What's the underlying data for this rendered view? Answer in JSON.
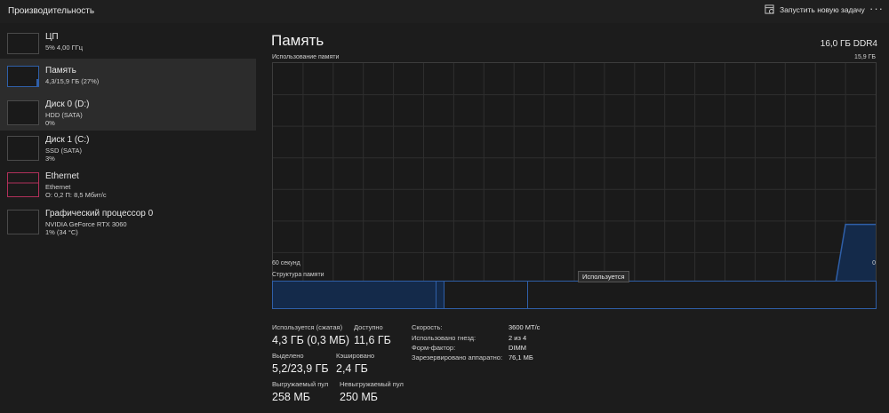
{
  "header": {
    "title": "Производительность",
    "run_task_label": "Запустить новую задачу",
    "more_label": "···"
  },
  "sidebar": {
    "items": [
      {
        "name": "ЦП",
        "subs": [
          "5% 4,00 ГГц"
        ]
      },
      {
        "name": "Память",
        "subs": [
          "4,3/15,9 ГБ (27%)"
        ]
      },
      {
        "name": "Диск 0 (D:)",
        "subs": [
          "HDD (SATA)",
          "0%"
        ]
      },
      {
        "name": "Диск 1 (C:)",
        "subs": [
          "SSD (SATA)",
          "3%"
        ]
      },
      {
        "name": "Ethernet",
        "subs": [
          "Ethernet",
          "О: 0,2 П: 8,5 Мбит/с"
        ]
      },
      {
        "name": "Графический процессор 0",
        "subs": [
          "NVIDIA GeForce RTX 3060",
          "1% (34 °C)"
        ]
      }
    ]
  },
  "main": {
    "title": "Память",
    "capacity": "16,0 ГБ DDR4",
    "usage_label": "Использование памяти",
    "usage_max": "15,9 ГБ",
    "time_label": "60 секунд",
    "zero_label": "0",
    "structure_label": "Структура памяти",
    "tooltip": "Используется"
  },
  "stats": {
    "in_use_label": "Используется (сжатая)",
    "in_use_value": "4,3 ГБ (0,3 МБ)",
    "available_label": "Доступно",
    "available_value": "11,6 ГБ",
    "committed_label": "Выделено",
    "committed_value": "5,2/23,9 ГБ",
    "cached_label": "Кэшировано",
    "cached_value": "2,4 ГБ",
    "paged_label": "Выгружаемый пул",
    "paged_value": "258 МБ",
    "nonpaged_label": "Невыгружаемый пул",
    "nonpaged_value": "250 МБ"
  },
  "details": [
    {
      "key": "Скорость:",
      "value": "3600 МТ/с"
    },
    {
      "key": "Использовано гнезд:",
      "value": "2 из 4"
    },
    {
      "key": "Форм-фактор:",
      "value": "DIMM"
    },
    {
      "key": "Зарезервировано аппаратно:",
      "value": "76,1 МБ"
    }
  ],
  "colors": {
    "memory_accent": "#2f5fa8",
    "memory_fill": "#142a4a",
    "ethernet_accent": "#b0305a",
    "grid": "#2e2e2e"
  },
  "chart_data": {
    "type": "area",
    "ylabel": "Использование памяти",
    "xlabel": "60 секунд",
    "ylim": [
      0,
      15.9
    ],
    "x": [
      -60,
      -4,
      -3,
      0
    ],
    "values": [
      0,
      0,
      4.3,
      4.3
    ]
  }
}
